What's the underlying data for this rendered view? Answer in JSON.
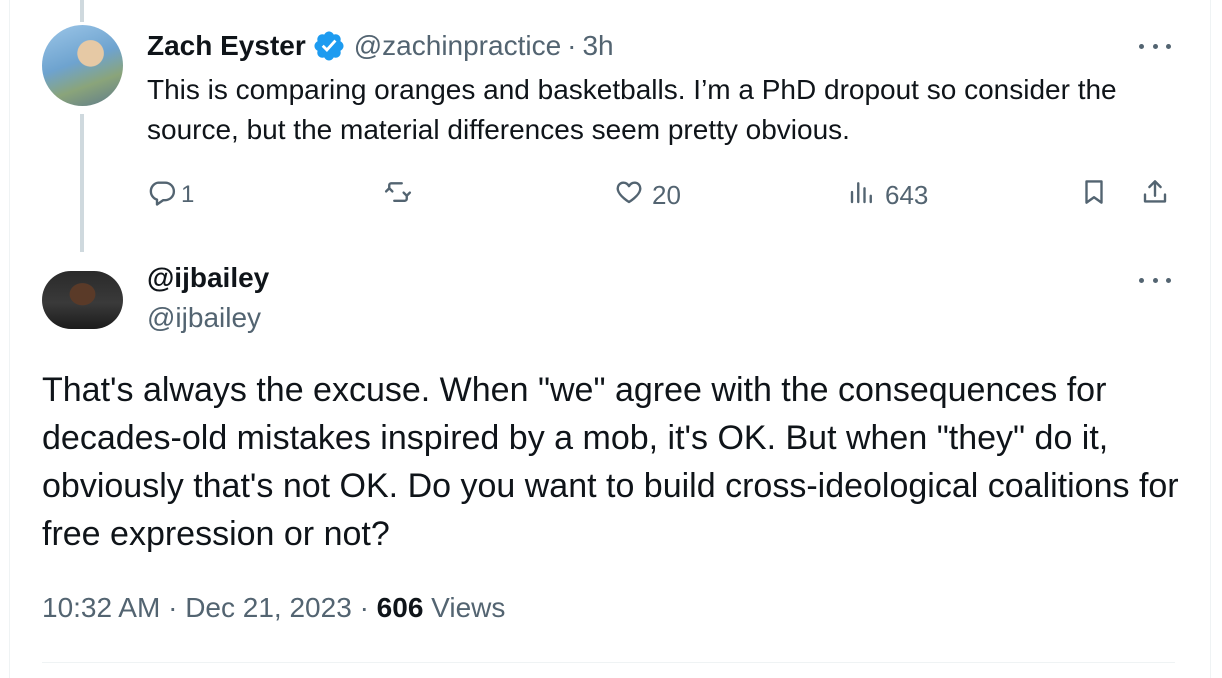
{
  "reply": {
    "author_name": "Zach Eyster",
    "handle": "@zachinpractice",
    "separator": "·",
    "time": "3h",
    "text": "This is comparing oranges and basketballs. I’m a PhD dropout so consider the source, but the material differences seem pretty obvious.",
    "counts": {
      "replies": "1",
      "likes": "20",
      "views": "643"
    },
    "icons": [
      "verified-badge-icon",
      "reply-icon",
      "retweet-icon",
      "like-icon",
      "views-icon",
      "bookmark-icon",
      "share-icon",
      "more-icon"
    ]
  },
  "main_tweet": {
    "display_name": "@ijbailey",
    "handle": "@ijbailey",
    "text": "That's always the excuse. When \"we\" agree with the consequences for decades-old mistakes inspired by a mob, it's OK. But when \"they\" do it, obviously that's not OK. Do you want to build cross-ideological coalitions for free expression or not?",
    "time": "10:32 AM",
    "sep1": "·",
    "date": "Dec 21, 2023",
    "sep2": "·",
    "views_count": "606",
    "views_label": "Views"
  },
  "colors": {
    "text": "#0f1419",
    "muted": "#536471",
    "verified": "#1d9bf0",
    "thread_line": "#cfd9de"
  }
}
